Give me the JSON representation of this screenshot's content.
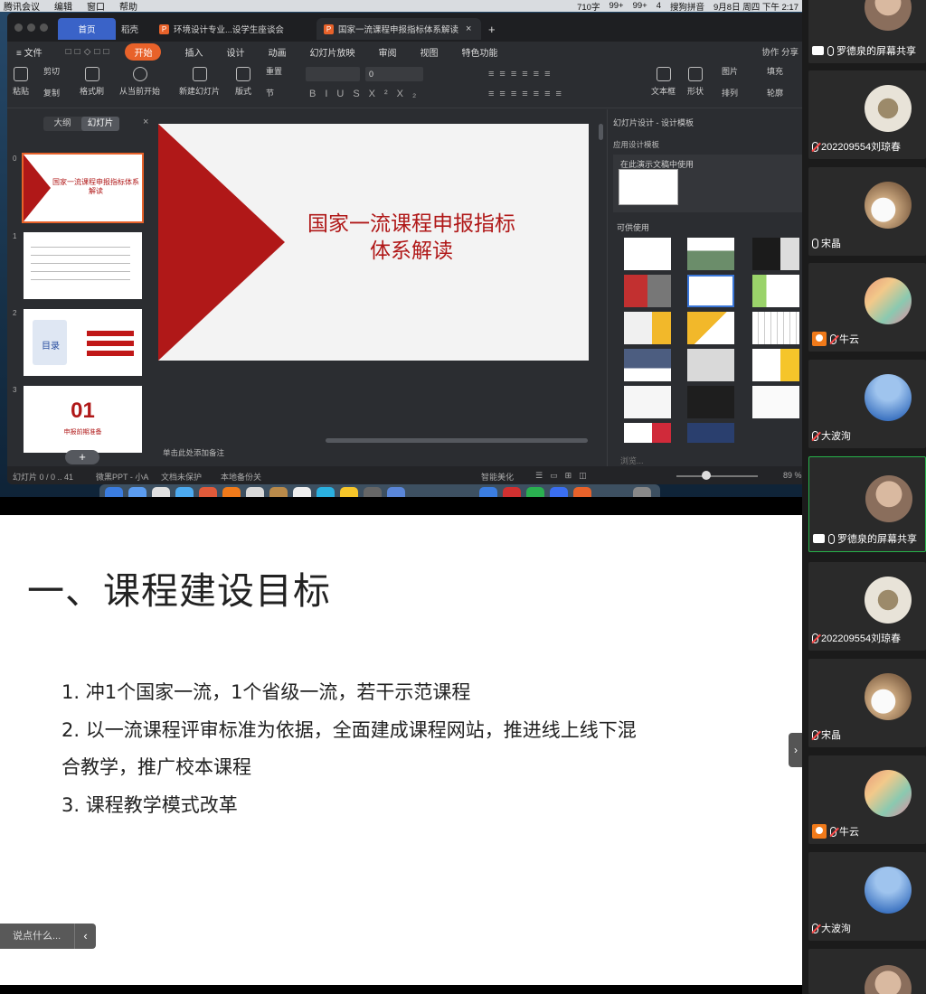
{
  "menubar": {
    "items": [
      "腾讯会议",
      "编辑",
      "窗口",
      "帮助"
    ],
    "status": [
      "710字",
      "99+",
      "99+",
      "4",
      "搜狗拼音",
      "9月8日 周四 下午 2:17"
    ]
  },
  "wps": {
    "tabs": {
      "home": "首页",
      "daoke": "稻壳",
      "doc1": "环境设计专业...设学生座谈会",
      "doc2": "国家一流课程申报指标体系解读"
    },
    "menu": {
      "file": "文件",
      "start": "开始",
      "insert": "插入",
      "design": "设计",
      "animation": "动画",
      "slideshow": "幻灯片放映",
      "review": "审阅",
      "view": "视图",
      "special": "特色功能",
      "collab": "协作",
      "share": "分享"
    },
    "ribbon": {
      "paste": "粘贴",
      "cut": "剪切",
      "copy": "复制",
      "format_painter": "格式刷",
      "from_current": "从当前开始",
      "new_slide": "新建幻灯片",
      "layout": "版式",
      "reset": "重置",
      "section": "节",
      "font_size": "0",
      "textbox": "文本框",
      "shape": "形状",
      "arrange": "排列",
      "picture": "图片",
      "fill": "填充",
      "outline": "轮廓"
    },
    "left_pane": {
      "outline_tab": "大纲",
      "slides_tab": "幻灯片",
      "add": "+"
    },
    "thumbs": [
      {
        "num": "0",
        "title": "国家一流课程申报指标体系解读"
      },
      {
        "num": "1"
      },
      {
        "num": "2",
        "toc": "目录"
      },
      {
        "num": "3",
        "big": "01",
        "sub": "申报前期准备"
      }
    ],
    "slide": {
      "title_line1": "国家一流课程申报指标",
      "title_line2": "体系解读"
    },
    "notes_placeholder": "单击此处添加备注",
    "right_pane": {
      "header": "幻灯片设计 - 设计模板",
      "applied": "应用设计模板",
      "in_use": "在此演示文稿中使用",
      "available": "可供使用",
      "browse": "浏览..."
    },
    "status": {
      "slide": "幻灯片 0 / 0 .. 41",
      "theme": "微黑PPT - 小A",
      "protect": "文档未保护",
      "backup": "本地备份关",
      "beautify": "智能美化",
      "zoom": "89 %"
    }
  },
  "main_slide": {
    "heading": "一、课程建设目标",
    "items": [
      "1. 冲1个国家一流，1个省级一流，若干示范课程",
      "2. 以一流课程评审标准为依据，全面建成课程网站，推进线上线下混",
      "合教学，推广校本课程",
      "3. 课程教学模式改革"
    ]
  },
  "chat": {
    "placeholder": "说点什么...",
    "arrow": "‹"
  },
  "collapse_arrow": "›",
  "participants": [
    {
      "name": "罗德泉的屏幕共享",
      "type": "screen",
      "avatar": "person-glasses"
    },
    {
      "name": "202209554刘琼春",
      "type": "muted",
      "avatar": "room"
    },
    {
      "name": "宋晶",
      "type": "mic",
      "avatar": "pet"
    },
    {
      "name": "牛云",
      "type": "host-muted",
      "avatar": "colorful"
    },
    {
      "name": "大波洵",
      "type": "muted",
      "avatar": "sky"
    },
    {
      "name": "罗德泉的屏幕共享",
      "type": "screen",
      "avatar": "person-glasses"
    },
    {
      "name": "202209554刘琼春",
      "type": "muted",
      "avatar": "room"
    },
    {
      "name": "宋晶",
      "type": "muted",
      "avatar": "pet"
    },
    {
      "name": "牛云",
      "type": "host-muted",
      "avatar": "colorful"
    },
    {
      "name": "大波洵",
      "type": "muted",
      "avatar": "sky"
    }
  ],
  "colors": {
    "accent": "#e8622a",
    "slide_red": "#b01818",
    "active_speaker": "#27b34a"
  }
}
